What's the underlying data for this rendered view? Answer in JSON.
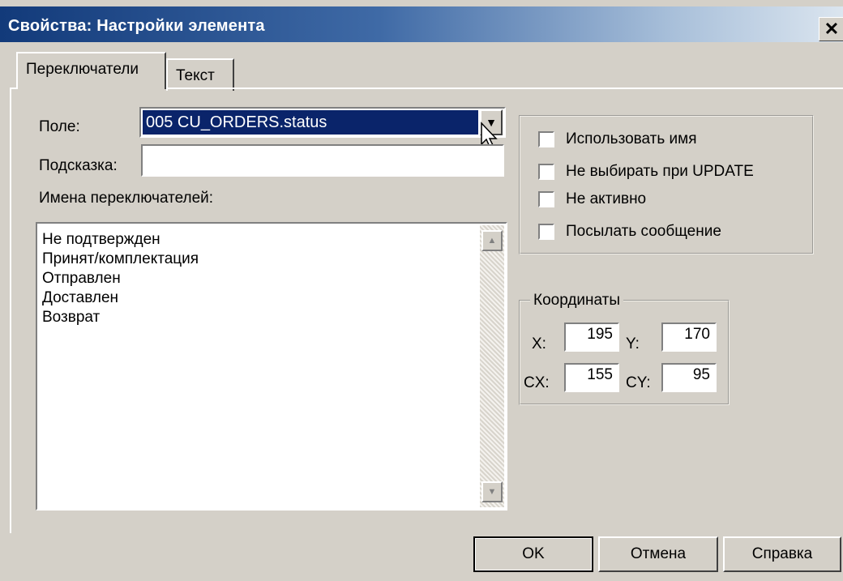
{
  "window": {
    "title": "Свойства: Настройки элемента",
    "close_glyph": "✕"
  },
  "tabs": [
    {
      "label": "Переключатели",
      "active": true
    },
    {
      "label": "Текст",
      "active": false
    }
  ],
  "form": {
    "field_label": "Поле:",
    "field_value": "005 CU_ORDERS.status",
    "hint_label": "Подсказка:",
    "hint_value": "",
    "switch_names_label": "Имена переключателей:",
    "switch_names": [
      "Не подтвержден",
      "Принят/комплектация",
      "Отправлен",
      "Доставлен",
      "Возврат"
    ]
  },
  "checkboxes": [
    {
      "label": "Использовать имя",
      "checked": false
    },
    {
      "label": "Не выбирать при UPDATE",
      "checked": false
    },
    {
      "label": "Не активно",
      "checked": false
    },
    {
      "label": "Посылать сообщение",
      "checked": false
    }
  ],
  "coordinates": {
    "legend": "Координаты",
    "x_label": "X:",
    "x": "195",
    "y_label": "Y:",
    "y": "170",
    "cx_label": "CX:",
    "cx": "155",
    "cy_label": "CY:",
    "cy": "95"
  },
  "buttons": {
    "ok": "OK",
    "cancel": "Отмена",
    "help": "Справка"
  }
}
